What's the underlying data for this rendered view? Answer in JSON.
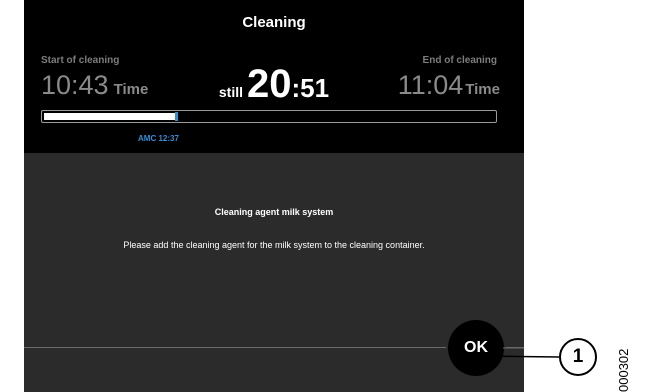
{
  "header": {
    "title": "Cleaning"
  },
  "timing": {
    "start_label": "Start of cleaning",
    "start_time": "10:43",
    "start_unit": "Time",
    "end_label": "End of cleaning",
    "end_time": "11:04",
    "end_unit": "Time",
    "remaining_prefix": "still",
    "remaining_minutes": "20",
    "remaining_seconds": ":51"
  },
  "progress": {
    "fraction": 0.29,
    "marker_label": "AMC 12:37",
    "marker_color": "#2f8fd6"
  },
  "message": {
    "title": "Cleaning agent milk system",
    "body": "Please add the cleaning agent for the milk system to the cleaning container."
  },
  "actions": {
    "ok_label": "OK"
  },
  "annotation": {
    "callout_number": "1",
    "document_id": "000302"
  },
  "colors": {
    "header_bg": "#000000",
    "panel_bg": "#2b2b2b",
    "accent": "#2f8fd6",
    "muted_text": "#8a8a8a"
  }
}
